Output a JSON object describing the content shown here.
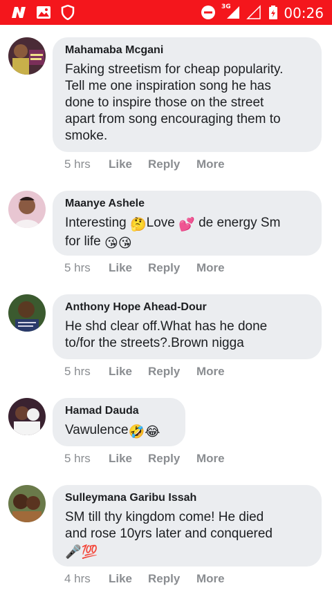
{
  "status_bar": {
    "network": "3G",
    "time": "00:26",
    "icons": [
      "app-n-icon",
      "image-icon",
      "shield-icon",
      "do-not-disturb-icon",
      "signal-icon",
      "signal-empty-icon",
      "battery-icon"
    ]
  },
  "comments": [
    {
      "name": "Mahamaba Mcgani",
      "text": "Faking streetism for cheap popularity.\nTell me one inspiration song he has\ndone to inspire those on the street\napart from song encouraging them to\nsmoke.",
      "time": "5 hrs",
      "like": "Like",
      "reply": "Reply",
      "more": "More",
      "avatar_color": "#4a2b36"
    },
    {
      "name": "Maanye Ashele",
      "text_parts": [
        "Interesting ",
        "🤔",
        "Love ",
        "💕",
        " de energy Sm",
        "for life ",
        "😘😘"
      ],
      "time": "5 hrs",
      "like": "Like",
      "reply": "Reply",
      "more": "More",
      "avatar_color": "#c98a9e"
    },
    {
      "name": "Anthony Hope Ahead-Dour",
      "text": "He shd clear off.What has he done\nto/for the streets?.Brown nigga",
      "time": "5 hrs",
      "like": "Like",
      "reply": "Reply",
      "more": "More",
      "avatar_color": "#3b5a2f"
    },
    {
      "name": "Hamad Dauda",
      "text_parts": [
        "Vawulence",
        "🤣😂"
      ],
      "time": "5 hrs",
      "like": "Like",
      "reply": "Reply",
      "more": "More",
      "avatar_color": "#3a2230"
    },
    {
      "name": "Sulleymana Garibu Issah",
      "text_parts": [
        "SM till thy kingdom come! He died\nand rose 10yrs later and conquered",
        "🎤💯"
      ],
      "time": "4 hrs",
      "like": "Like",
      "reply": "Reply",
      "more": "More",
      "avatar_color": "#5a4030"
    }
  ]
}
